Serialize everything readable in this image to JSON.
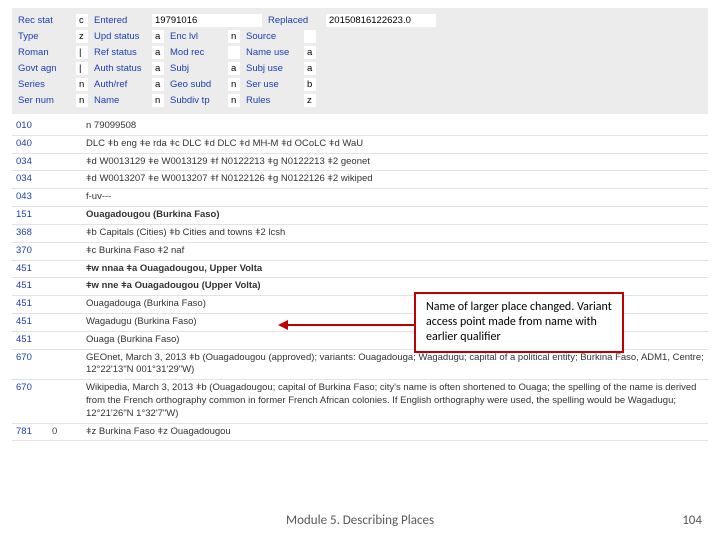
{
  "header": {
    "rows": [
      [
        {
          "label": "Rec stat",
          "val": "c"
        },
        {
          "label": "Entered",
          "val": "19791016",
          "cls": "w-long"
        },
        {
          "label": "Replaced",
          "val": "20150816122623.0",
          "cls": "w-long"
        }
      ],
      [
        {
          "label": "Type",
          "val": "z"
        },
        {
          "label": "Upd status",
          "val": "a"
        },
        {
          "label": "Enc lvl",
          "val": "n"
        },
        {
          "label": "Source",
          "val": ""
        }
      ],
      [
        {
          "label": "Roman",
          "val": "|"
        },
        {
          "label": "Ref status",
          "val": "a"
        },
        {
          "label": "Mod rec",
          "val": ""
        },
        {
          "label": "Name use",
          "val": "a"
        }
      ],
      [
        {
          "label": "Govt agn",
          "val": "|"
        },
        {
          "label": "Auth status",
          "val": "a"
        },
        {
          "label": "Subj",
          "val": "a"
        },
        {
          "label": "Subj use",
          "val": "a"
        }
      ],
      [
        {
          "label": "Series",
          "val": "n"
        },
        {
          "label": "Auth/ref",
          "val": "a"
        },
        {
          "label": "Geo subd",
          "val": "n"
        },
        {
          "label": "Ser use",
          "val": "b"
        }
      ],
      [
        {
          "label": "Ser num",
          "val": "n"
        },
        {
          "label": "Name",
          "val": "n"
        },
        {
          "label": "Subdiv tp",
          "val": "n"
        },
        {
          "label": "Rules",
          "val": "z"
        }
      ]
    ]
  },
  "marc": [
    {
      "tag": "010",
      "ind": "",
      "data": "n  79099508"
    },
    {
      "tag": "040",
      "ind": "",
      "data": "DLC ǂb eng ǂe rda ǂc DLC ǂd DLC ǂd MH-M ǂd OCoLC ǂd WaU"
    },
    {
      "tag": "034",
      "ind": "",
      "data": "ǂd W0013129 ǂe W0013129 ǂf N0122213 ǂg N0122213 ǂ2 geonet"
    },
    {
      "tag": "034",
      "ind": "",
      "data": "ǂd W0013207 ǂe W0013207 ǂf N0122126 ǂg N0122126 ǂ2 wikiped"
    },
    {
      "tag": "043",
      "ind": "",
      "data": "f-uv---"
    },
    {
      "tag": "151",
      "ind": "",
      "data": "Ouagadougou (Burkina Faso)",
      "bold": true
    },
    {
      "tag": "368",
      "ind": "",
      "data": "ǂb Capitals (Cities) ǂb Cities and towns ǂ2 lcsh"
    },
    {
      "tag": "370",
      "ind": "",
      "data": "ǂc Burkina Faso ǂ2 naf"
    },
    {
      "tag": "451",
      "ind": "",
      "data": "ǂw nnaa ǂa Ouagadougou, Upper Volta",
      "bold": true
    },
    {
      "tag": "451",
      "ind": "",
      "data": "ǂw nne ǂa Ouagadougou (Upper Volta)",
      "bold": true
    },
    {
      "tag": "451",
      "ind": "",
      "data": "Ouagadouga (Burkina Faso)"
    },
    {
      "tag": "451",
      "ind": "",
      "data": "Wagadugu (Burkina Faso)"
    },
    {
      "tag": "451",
      "ind": "",
      "data": "Ouaga (Burkina Faso)"
    },
    {
      "tag": "670",
      "ind": "",
      "data": "GEOnet, March 3, 2013 ǂb (Ouagadougou (approved); variants: Ouagadouga; Wagadugu; capital of a political entity; Burkina Faso, ADM1, Centre; 12°22'13\"N 001°31'29\"W)"
    },
    {
      "tag": "670",
      "ind": "",
      "data": "Wikipedia, March 3, 2013 ǂb (Ouagadougou; capital of Burkina Faso; city's name is often shortened to Ouaga; the spelling of the name is derived from the French orthography common in former French African colonies. If English orthography were used, the spelling would be Wagadugu; 12°21'26\"N 1°32'7\"W)"
    },
    {
      "tag": "781",
      "ind": "0",
      "data": "ǂz Burkina Faso ǂz Ouagadougou"
    }
  ],
  "callout": "Name of larger place changed. Variant access point made from name with earlier qualifier",
  "footer": {
    "title": "Module 5. Describing Places",
    "page": "104"
  }
}
